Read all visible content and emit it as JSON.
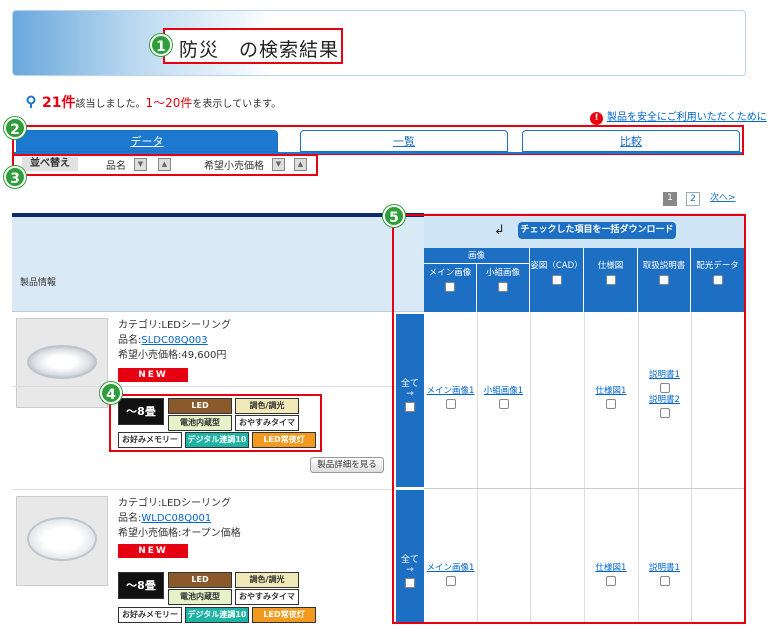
{
  "title": "防災　の検索結果",
  "badges": [
    "1",
    "2",
    "3",
    "4",
    "5"
  ],
  "result": {
    "count": "21件",
    "text1": "該当しました。",
    "range": "1～20件",
    "text2": "を表示しています。"
  },
  "safety_link": "製品を安全にご利用いただくために",
  "tabs": [
    "データ",
    "一覧",
    "比較"
  ],
  "sort": {
    "label": "並べ替え",
    "field1": "品名",
    "field2": "希望小売価格",
    "down_arrow": "▼",
    "up_arrow": "▲"
  },
  "pager": {
    "current": "1",
    "next_page": "2",
    "next": "次へ>"
  },
  "table": {
    "product_header": "製品情報",
    "download_button": "チェックした項目を一括ダウンロード",
    "image_group": "画像",
    "columns": [
      "メイン画像",
      "小組画像",
      "姿図（CAD）",
      "仕様図",
      "取扱説明書",
      "配光データ"
    ],
    "all_label": "全て"
  },
  "products": [
    {
      "category": "カテゴリ:LEDシーリング",
      "name_label": "品名:",
      "name": "SLDC08Q003",
      "price": "希望小売価格:49,600円",
      "new_label": "NEW",
      "tags": [
        "～8畳",
        "LED",
        "調色/調光",
        "電池内蔵型",
        "おやすみタイマー",
        "お好みメモリー",
        "デジタル連調10",
        "LED常夜灯"
      ],
      "links": {
        "main": "メイン画像1",
        "sub": "小組画像1",
        "spec": "仕様図1",
        "manual1": "説明書1",
        "manual2": "説明書2"
      },
      "detail_button": "製品詳細を見る"
    },
    {
      "category": "カテゴリ:LEDシーリング",
      "name_label": "品名:",
      "name": "WLDC08Q001",
      "price": "希望小売価格:オープン価格",
      "new_label": "NEW",
      "tags": [
        "～8畳",
        "LED",
        "調色/調光",
        "電池内蔵型",
        "おやすみタイマー",
        "お好みメモリー",
        "デジタル連調10",
        "LED常夜灯"
      ],
      "links": {
        "main": "メイン画像1",
        "spec": "仕様図1",
        "manual1": "説明書1"
      }
    }
  ],
  "colors": {
    "accent_blue": "#1d6fc4",
    "highlight_red": "#e60012",
    "badge_green": "#2e9d3a"
  }
}
